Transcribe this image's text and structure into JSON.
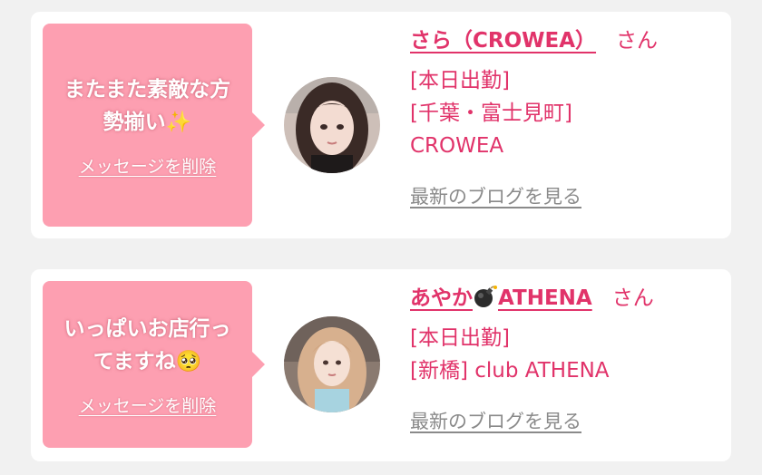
{
  "messages": [
    {
      "bubble_text": "またまた素敵な方勢揃い",
      "bubble_emoji": "✨",
      "delete_label": "メッセージを削除",
      "name_prefix": "さら（CROWEA）",
      "name_suffix": "",
      "honorific": "さん",
      "status": "[本日出勤]",
      "location": "[千葉・富士見町] CROWEA",
      "blog_label": "最新のブログを見る",
      "avatar_icon": "portrait-dark-hair"
    },
    {
      "bubble_text": "いっぱいお店行ってますね",
      "bubble_emoji": "🥺",
      "delete_label": "メッセージを削除",
      "name_prefix": "あやか",
      "name_icon": "bomb-icon",
      "name_suffix": "ATHENA",
      "honorific": "さん",
      "status": "[本日出勤]",
      "location": "[新橋] club ATHENA",
      "blog_label": "最新のブログを見る",
      "avatar_icon": "portrait-light-hair"
    }
  ],
  "colors": {
    "page_bg": "#f1f1f1",
    "bubble": "#fd9fb1",
    "accent": "#e1336a",
    "muted_link": "#8a8a8a"
  }
}
